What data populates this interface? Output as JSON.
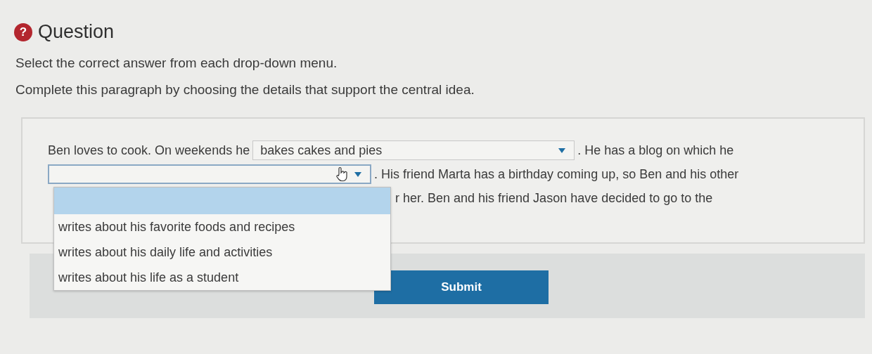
{
  "header": {
    "icon": "?",
    "title": "Question"
  },
  "instructions": [
    "Select the correct answer from each drop-down menu.",
    "Complete this paragraph by choosing the details that support the central idea."
  ],
  "paragraph": [
    [
      {
        "kind": "text",
        "text": "Ben loves to cook. On weekends he"
      },
      {
        "kind": "select",
        "value": "bakes cakes and pies",
        "open": false
      },
      {
        "kind": "text",
        "text": ". He has a blog on which he"
      }
    ],
    [
      {
        "kind": "select",
        "open": true,
        "options": [
          {
            "selected": true
          },
          {
            "label": "writes about his favorite foods and recipes",
            "selected": false
          },
          {
            "label": "writes about his daily life and activities",
            "selected": false
          },
          {
            "label": "writes about his life as a student",
            "selected": false
          }
        ]
      },
      {
        "kind": "text",
        "text": ". His friend Marta has a birthday coming up, so Ben and his other"
      }
    ],
    [
      {
        "kind": "gap"
      },
      {
        "kind": "text",
        "text": "r her. Ben and his friend Jason have decided to go to the"
      }
    ]
  ],
  "submit": "Submit"
}
